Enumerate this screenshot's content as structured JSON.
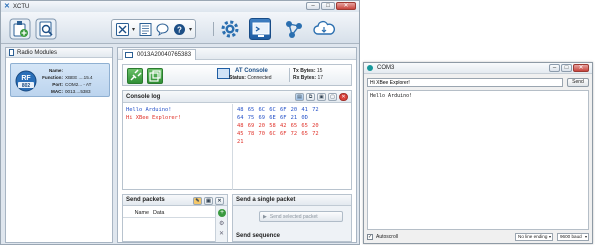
{
  "xctu": {
    "title": "XCTU",
    "window_controls": {
      "minimize": "–",
      "maximize": "□",
      "close": "✕"
    },
    "radio_modules": {
      "header": "Radio Modules",
      "module": {
        "badge_text": "RF",
        "badge_sub": "802",
        "name_label": "Name:",
        "name_value": "",
        "function_label": "Function:",
        "function_value": "XBEE ....15.4",
        "port_label": "Port:",
        "port_value": "COM2... - AT",
        "mac_label": "MAC:",
        "mac_value": "0013....5383"
      }
    },
    "device_tab": {
      "label": "0013A20040765383"
    },
    "console": {
      "mode_title": "AT Console",
      "status_label": "Status:",
      "status_value": "Connected",
      "tx_label": "Tx Bytes:",
      "tx_value": "15",
      "rx_label": "Rx Bytes:",
      "rx_value": "17"
    },
    "console_log": {
      "header": "Console log",
      "lines": [
        {
          "text": "Hello Arduino!",
          "color": "blue"
        },
        {
          "text": "Hi XBee Explorer!",
          "color": "red"
        }
      ],
      "hex_lines": [
        {
          "text": "48 65 6C 6C 6F 20 41 72",
          "color": "blue"
        },
        {
          "text": "64 75 69 6E 6F 21 0D",
          "color": "blue"
        },
        {
          "text": "48 69 20 58 42 65 65 20",
          "color": "red"
        },
        {
          "text": "45 78 70 6C 6F 72 65 72",
          "color": "red"
        },
        {
          "text": "21",
          "color": "red"
        }
      ]
    },
    "send_packets": {
      "header": "Send packets",
      "col_name": "Name",
      "col_data": "Data"
    },
    "send_single": {
      "header": "Send a single packet",
      "button": "Send selected packet"
    },
    "send_sequence": {
      "header": "Send sequence"
    }
  },
  "com3": {
    "title": "COM3",
    "input_value": "Hi XBee Explorer!",
    "send_label": "Send",
    "output": "Hello Arduino!",
    "autoscroll_label": "Autoscroll",
    "line_ending": "No line ending",
    "baud": "9600 baud"
  },
  "colors": {
    "sent": "#2652c8",
    "received": "#e0332b",
    "accent": "#1d4f86",
    "connect_green": "#3a9a3f"
  }
}
